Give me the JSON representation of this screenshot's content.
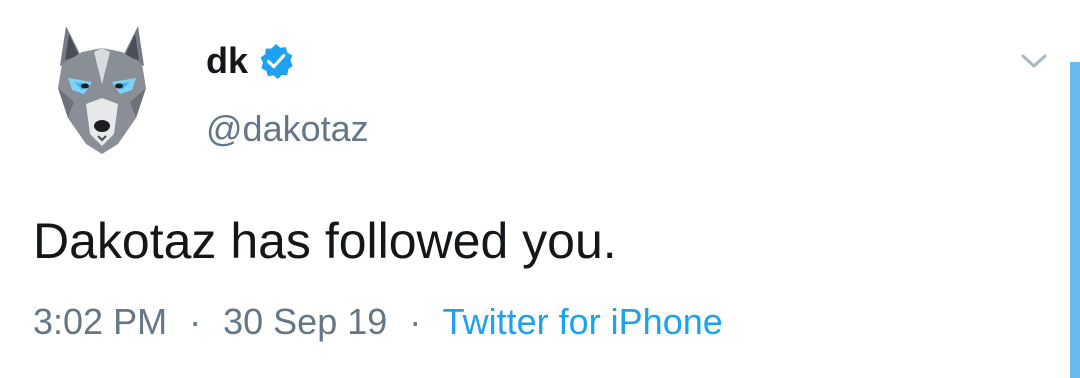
{
  "tweet": {
    "display_name": "dk",
    "verified": true,
    "handle": "@dakotaz",
    "text": "Dakotaz has followed you.",
    "time": "3:02 PM",
    "separator": "·",
    "date": "30 Sep 19",
    "source": "Twitter for iPhone"
  },
  "icons": {
    "avatar": "wolf-avatar-icon",
    "verified": "verified-badge-icon",
    "menu": "chevron-down-icon"
  },
  "colors": {
    "text_primary": "#14171a",
    "text_secondary": "#657786",
    "accent": "#1da1f2",
    "scroll_indicator": "#6bb9f1"
  }
}
